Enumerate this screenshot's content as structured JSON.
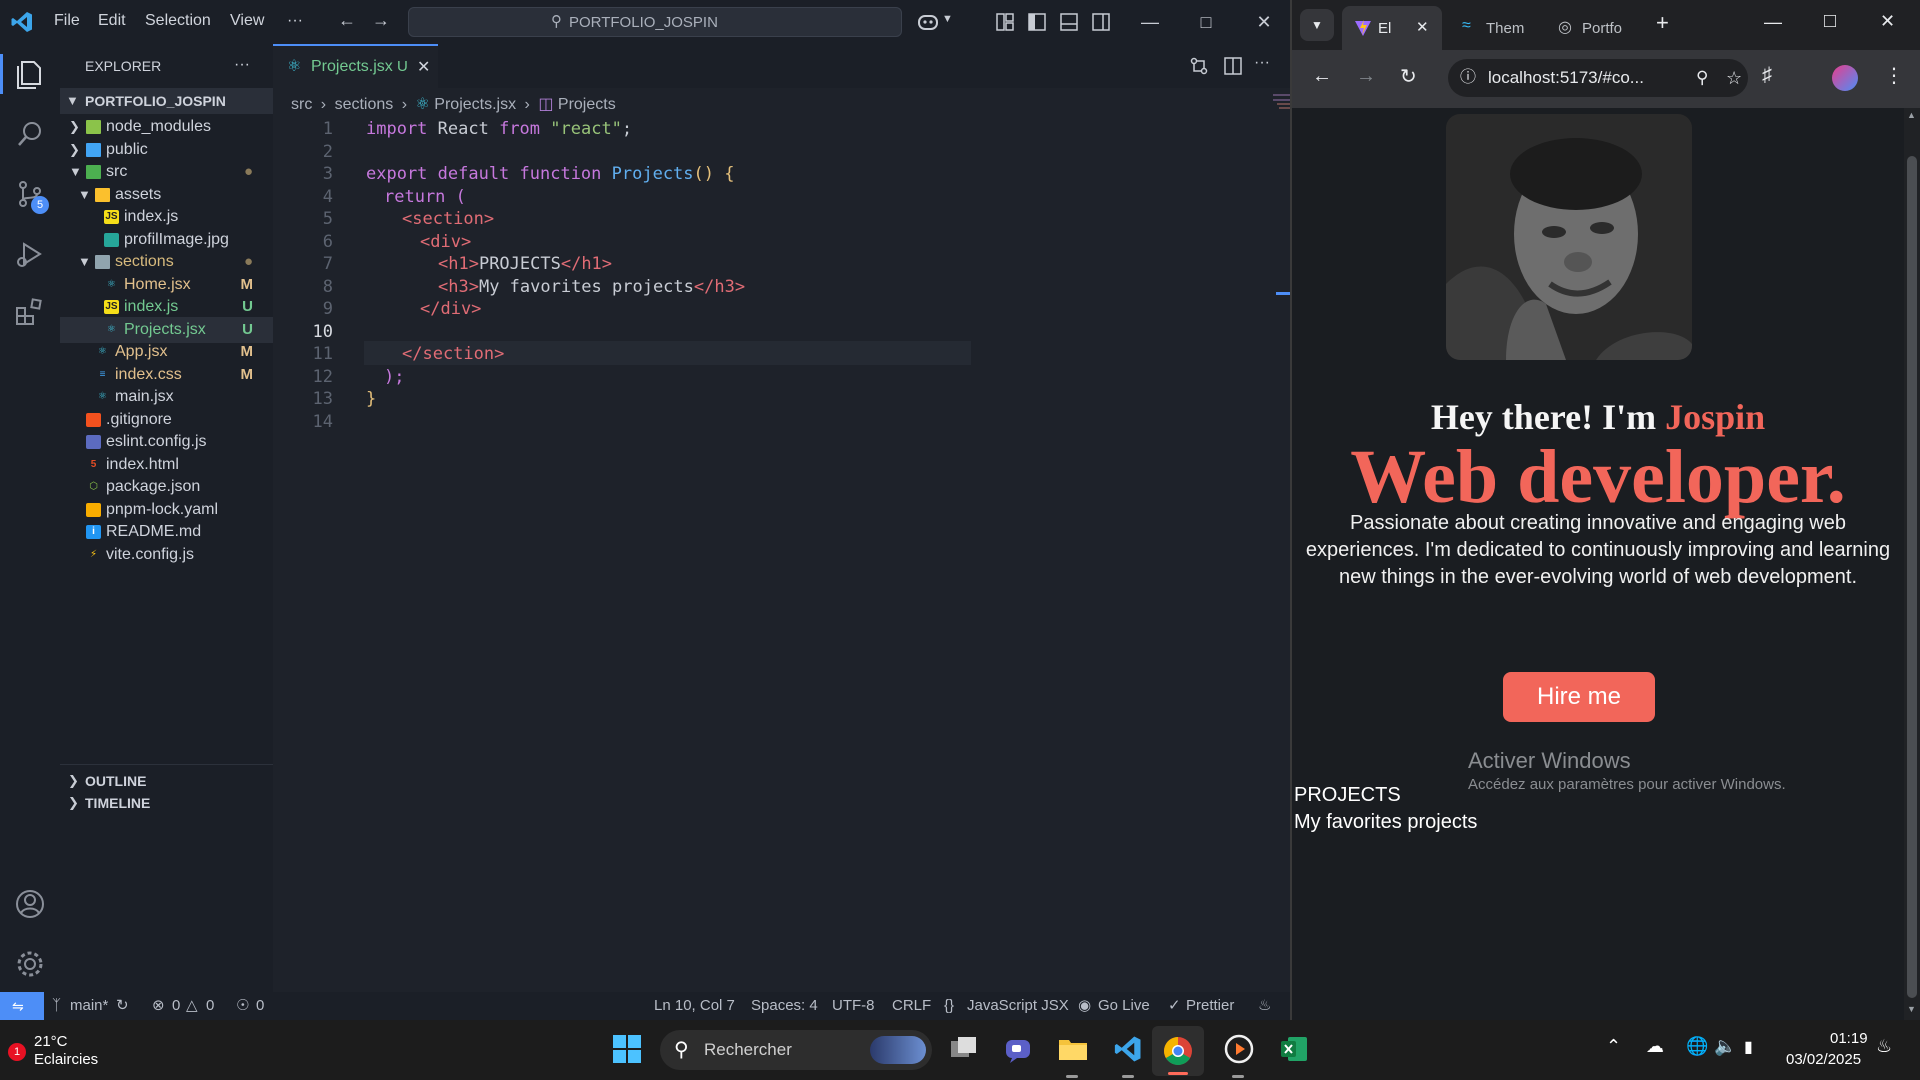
{
  "vscode": {
    "menu": [
      "File",
      "Edit",
      "Selection",
      "View",
      "···"
    ],
    "search_title": "PORTFOLIO_JOSPIN",
    "explorer_title": "EXPLORER",
    "explorer_more": "···",
    "root_folder": "PORTFOLIO_JOSPIN",
    "tree": [
      {
        "label": "node_modules",
        "badge": "",
        "color": "#cfd3dc"
      },
      {
        "label": "public",
        "badge": "",
        "color": "#cfd3dc"
      },
      {
        "label": "src",
        "badge": "●",
        "color": "#cfd3dc"
      },
      {
        "label": "assets",
        "badge": "",
        "color": "#cfd3dc"
      },
      {
        "label": "index.js",
        "badge": "",
        "color": "#cfd3dc"
      },
      {
        "label": "profilImage.jpg",
        "badge": "",
        "color": "#cfd3dc"
      },
      {
        "label": "sections",
        "badge": "●",
        "color": "#d7ba7d"
      },
      {
        "label": "Home.jsx",
        "badge": "M",
        "color": "#e2c08d"
      },
      {
        "label": "index.js",
        "badge": "U",
        "color": "#73c991"
      },
      {
        "label": "Projects.jsx",
        "badge": "U",
        "color": "#73c991"
      },
      {
        "label": "App.jsx",
        "badge": "M",
        "color": "#e2c08d"
      },
      {
        "label": "index.css",
        "badge": "M",
        "color": "#e2c08d"
      },
      {
        "label": "main.jsx",
        "badge": "",
        "color": "#cfd3dc"
      },
      {
        "label": ".gitignore",
        "badge": "",
        "color": "#cfd3dc"
      },
      {
        "label": "eslint.config.js",
        "badge": "",
        "color": "#cfd3dc"
      },
      {
        "label": "index.html",
        "badge": "",
        "color": "#cfd3dc"
      },
      {
        "label": "package.json",
        "badge": "",
        "color": "#cfd3dc"
      },
      {
        "label": "pnpm-lock.yaml",
        "badge": "",
        "color": "#cfd3dc"
      },
      {
        "label": "README.md",
        "badge": "",
        "color": "#cfd3dc"
      },
      {
        "label": "vite.config.js",
        "badge": "",
        "color": "#cfd3dc"
      }
    ],
    "outline_label": "OUTLINE",
    "timeline_label": "TIMELINE",
    "tab_label": "Projects.jsx",
    "tab_badge": "U",
    "breadcrumb": {
      "a": "src",
      "b": "sections",
      "c": "Projects.jsx",
      "d": "Projects"
    },
    "line_numbers": [
      "1",
      "2",
      "3",
      "4",
      "5",
      "6",
      "7",
      "8",
      "9",
      "10",
      "11",
      "12",
      "13",
      "14"
    ],
    "code": {
      "l1_kw": "import",
      "l1_id": " React ",
      "l1_from": "from",
      "l1_str": " \"react\"",
      "l1_end": ";",
      "l3_kw": "export default function ",
      "l3_fn": "Projects",
      "l3_end": "() {",
      "l4": "return (",
      "l5": "<section>",
      "l6": "<div>",
      "l7_open": "<h1>",
      "l7_text": "PROJECTS",
      "l7_close": "</h1>",
      "l8_open": "<h3>",
      "l8_text": "My favorites projects",
      "l8_close": "</h3>",
      "l9": "</div>",
      "l11": "</section>",
      "l12": ");",
      "l13": "}"
    },
    "status": {
      "branch": "main*",
      "errors": "0",
      "warnings": "0",
      "ports": "0",
      "position": "Ln 10, Col 7",
      "spaces": "Spaces: 4",
      "encoding": "UTF-8",
      "eol": "CRLF",
      "language": "JavaScript JSX",
      "golive": "Go Live",
      "prettier": "Prettier"
    },
    "scm_badge": "5"
  },
  "browser": {
    "tabs": [
      "El",
      "Them",
      "Portfo"
    ],
    "address": "localhost:5173/#co...",
    "hero_greeting": "Hey there! I'm ",
    "hero_name": "Jospin",
    "hero_title": "Web developer.",
    "hero_text": "Passionate about creating innovative and engaging web experiences. I'm dedicated to continuously improving and learning new things in the ever-evolving world of web development.",
    "hire_button": "Hire me",
    "activate_title": "Activer Windows",
    "activate_sub": "Accédez aux paramètres pour activer Windows.",
    "projects_h1": "PROJECTS",
    "projects_h3": "My favorites projects",
    "accent": "#f2665a"
  },
  "taskbar": {
    "weather_temp": "21°C",
    "weather_desc": "Eclaircies",
    "weather_badge": "1",
    "search_placeholder": "Rechercher",
    "time": "01:19",
    "date": "03/02/2025"
  }
}
